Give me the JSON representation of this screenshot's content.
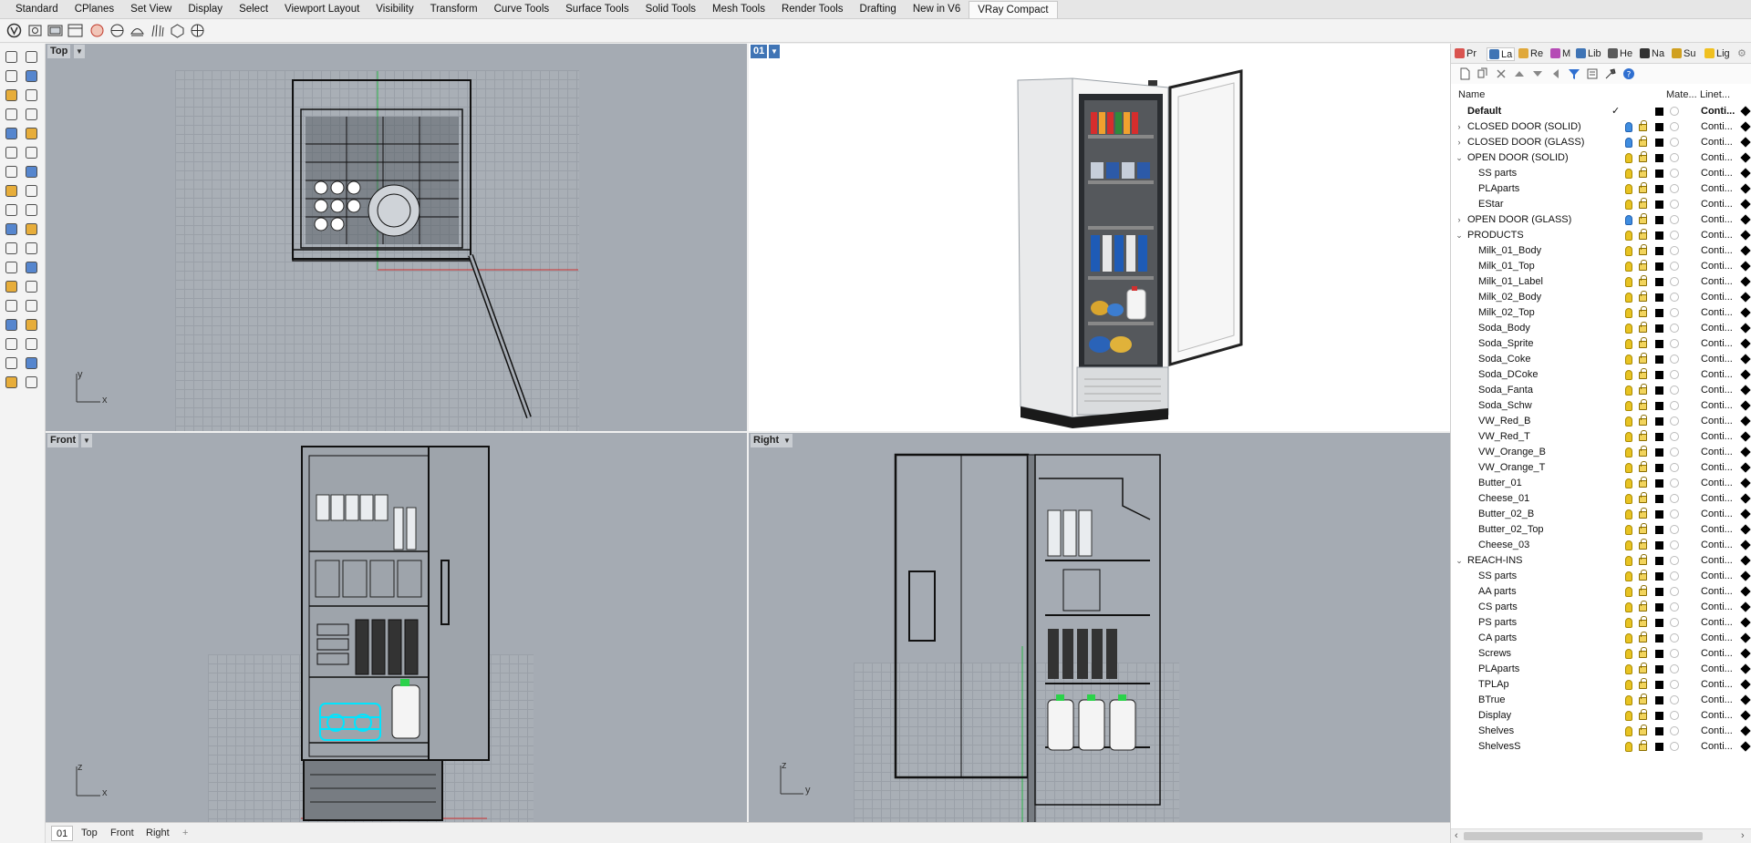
{
  "ribbon_tabs": [
    "Standard",
    "CPlanes",
    "Set View",
    "Display",
    "Select",
    "Viewport Layout",
    "Visibility",
    "Transform",
    "Curve Tools",
    "Surface Tools",
    "Solid Tools",
    "Mesh Tools",
    "Render Tools",
    "Drafting",
    "New in V6",
    "VRay Compact"
  ],
  "active_ribbon_tab": "VRay Compact",
  "viewports": {
    "top": {
      "label": "Top",
      "axis_a": "y",
      "axis_b": "x"
    },
    "perspective": {
      "label": "01"
    },
    "front": {
      "label": "Front",
      "axis_a": "z",
      "axis_b": "x"
    },
    "right": {
      "label": "Right",
      "axis_a": "z",
      "axis_b": "y"
    }
  },
  "viewport_tabs": [
    "01",
    "Top",
    "Front",
    "Right"
  ],
  "active_viewport_tab": "01",
  "panel": {
    "tabs": [
      "Pr",
      "La",
      "Re",
      "M",
      "Lib",
      "He",
      "Na",
      "Su",
      "Lig"
    ],
    "columns": {
      "name": "Name",
      "material": "Mate...",
      "linetype": "Linet..."
    },
    "layers": [
      {
        "name": "Default",
        "level": 0,
        "expander": "",
        "current": true,
        "bulb": "on",
        "linetype": "Conti..."
      },
      {
        "name": "CLOSED DOOR (SOLID)",
        "level": 0,
        "expander": ">",
        "bulb": "off",
        "linetype": "Conti..."
      },
      {
        "name": "CLOSED DOOR (GLASS)",
        "level": 0,
        "expander": ">",
        "bulb": "off",
        "linetype": "Conti..."
      },
      {
        "name": "OPEN DOOR (SOLID)",
        "level": 0,
        "expander": "v",
        "bulb": "on",
        "linetype": "Conti..."
      },
      {
        "name": "SS parts",
        "level": 1,
        "expander": "",
        "bulb": "on",
        "linetype": "Conti..."
      },
      {
        "name": "PLAparts",
        "level": 1,
        "expander": "",
        "bulb": "on",
        "linetype": "Conti..."
      },
      {
        "name": "EStar",
        "level": 1,
        "expander": "",
        "bulb": "on",
        "linetype": "Conti..."
      },
      {
        "name": "OPEN DOOR (GLASS)",
        "level": 0,
        "expander": ">",
        "bulb": "off",
        "linetype": "Conti..."
      },
      {
        "name": "PRODUCTS",
        "level": 0,
        "expander": "v",
        "bulb": "on",
        "linetype": "Conti..."
      },
      {
        "name": "Milk_01_Body",
        "level": 1,
        "expander": "",
        "bulb": "on",
        "linetype": "Conti..."
      },
      {
        "name": "Milk_01_Top",
        "level": 1,
        "expander": "",
        "bulb": "on",
        "linetype": "Conti..."
      },
      {
        "name": "Milk_01_Label",
        "level": 1,
        "expander": "",
        "bulb": "on",
        "linetype": "Conti..."
      },
      {
        "name": "Milk_02_Body",
        "level": 1,
        "expander": "",
        "bulb": "on",
        "linetype": "Conti..."
      },
      {
        "name": "Milk_02_Top",
        "level": 1,
        "expander": "",
        "bulb": "on",
        "linetype": "Conti..."
      },
      {
        "name": "Soda_Body",
        "level": 1,
        "expander": "",
        "bulb": "on",
        "linetype": "Conti..."
      },
      {
        "name": "Soda_Sprite",
        "level": 1,
        "expander": "",
        "bulb": "on",
        "linetype": "Conti..."
      },
      {
        "name": "Soda_Coke",
        "level": 1,
        "expander": "",
        "bulb": "on",
        "linetype": "Conti..."
      },
      {
        "name": "Soda_DCoke",
        "level": 1,
        "expander": "",
        "bulb": "on",
        "linetype": "Conti..."
      },
      {
        "name": "Soda_Fanta",
        "level": 1,
        "expander": "",
        "bulb": "on",
        "linetype": "Conti..."
      },
      {
        "name": "Soda_Schw",
        "level": 1,
        "expander": "",
        "bulb": "on",
        "linetype": "Conti..."
      },
      {
        "name": "VW_Red_B",
        "level": 1,
        "expander": "",
        "bulb": "on",
        "linetype": "Conti..."
      },
      {
        "name": "VW_Red_T",
        "level": 1,
        "expander": "",
        "bulb": "on",
        "linetype": "Conti..."
      },
      {
        "name": "VW_Orange_B",
        "level": 1,
        "expander": "",
        "bulb": "on",
        "linetype": "Conti..."
      },
      {
        "name": "VW_Orange_T",
        "level": 1,
        "expander": "",
        "bulb": "on",
        "linetype": "Conti..."
      },
      {
        "name": "Butter_01",
        "level": 1,
        "expander": "",
        "bulb": "on",
        "linetype": "Conti..."
      },
      {
        "name": "Cheese_01",
        "level": 1,
        "expander": "",
        "bulb": "on",
        "linetype": "Conti..."
      },
      {
        "name": "Butter_02_B",
        "level": 1,
        "expander": "",
        "bulb": "on",
        "linetype": "Conti..."
      },
      {
        "name": "Butter_02_Top",
        "level": 1,
        "expander": "",
        "bulb": "on",
        "linetype": "Conti..."
      },
      {
        "name": "Cheese_03",
        "level": 1,
        "expander": "",
        "bulb": "on",
        "linetype": "Conti..."
      },
      {
        "name": "REACH-INS",
        "level": 0,
        "expander": "v",
        "bulb": "on",
        "linetype": "Conti..."
      },
      {
        "name": "SS parts",
        "level": 1,
        "expander": "",
        "bulb": "on",
        "linetype": "Conti..."
      },
      {
        "name": "AA parts",
        "level": 1,
        "expander": "",
        "bulb": "on",
        "linetype": "Conti..."
      },
      {
        "name": "CS parts",
        "level": 1,
        "expander": "",
        "bulb": "on",
        "linetype": "Conti..."
      },
      {
        "name": "PS parts",
        "level": 1,
        "expander": "",
        "bulb": "on",
        "linetype": "Conti..."
      },
      {
        "name": "CA parts",
        "level": 1,
        "expander": "",
        "bulb": "on",
        "linetype": "Conti..."
      },
      {
        "name": "Screws",
        "level": 1,
        "expander": "",
        "bulb": "on",
        "linetype": "Conti..."
      },
      {
        "name": "PLAparts",
        "level": 1,
        "expander": "",
        "bulb": "on",
        "linetype": "Conti..."
      },
      {
        "name": "TPLAp",
        "level": 1,
        "expander": "",
        "bulb": "on",
        "linetype": "Conti..."
      },
      {
        "name": "BTrue",
        "level": 1,
        "expander": "",
        "bulb": "on",
        "linetype": "Conti..."
      },
      {
        "name": "Display",
        "level": 1,
        "expander": "",
        "bulb": "on",
        "linetype": "Conti..."
      },
      {
        "name": "Shelves",
        "level": 1,
        "expander": "",
        "bulb": "on",
        "linetype": "Conti..."
      },
      {
        "name": "ShelvesS",
        "level": 1,
        "expander": "",
        "bulb": "on",
        "linetype": "Conti..."
      }
    ]
  },
  "colors": {
    "viewport_bg": "#a5abb3",
    "active_tab": "#fafafa",
    "accent_blue": "#3f8de0",
    "bulb_yellow": "#e8c322",
    "cyan_selection": "#00e5ff",
    "green_axis": "#2bb54a",
    "red_axis": "#d03030"
  }
}
